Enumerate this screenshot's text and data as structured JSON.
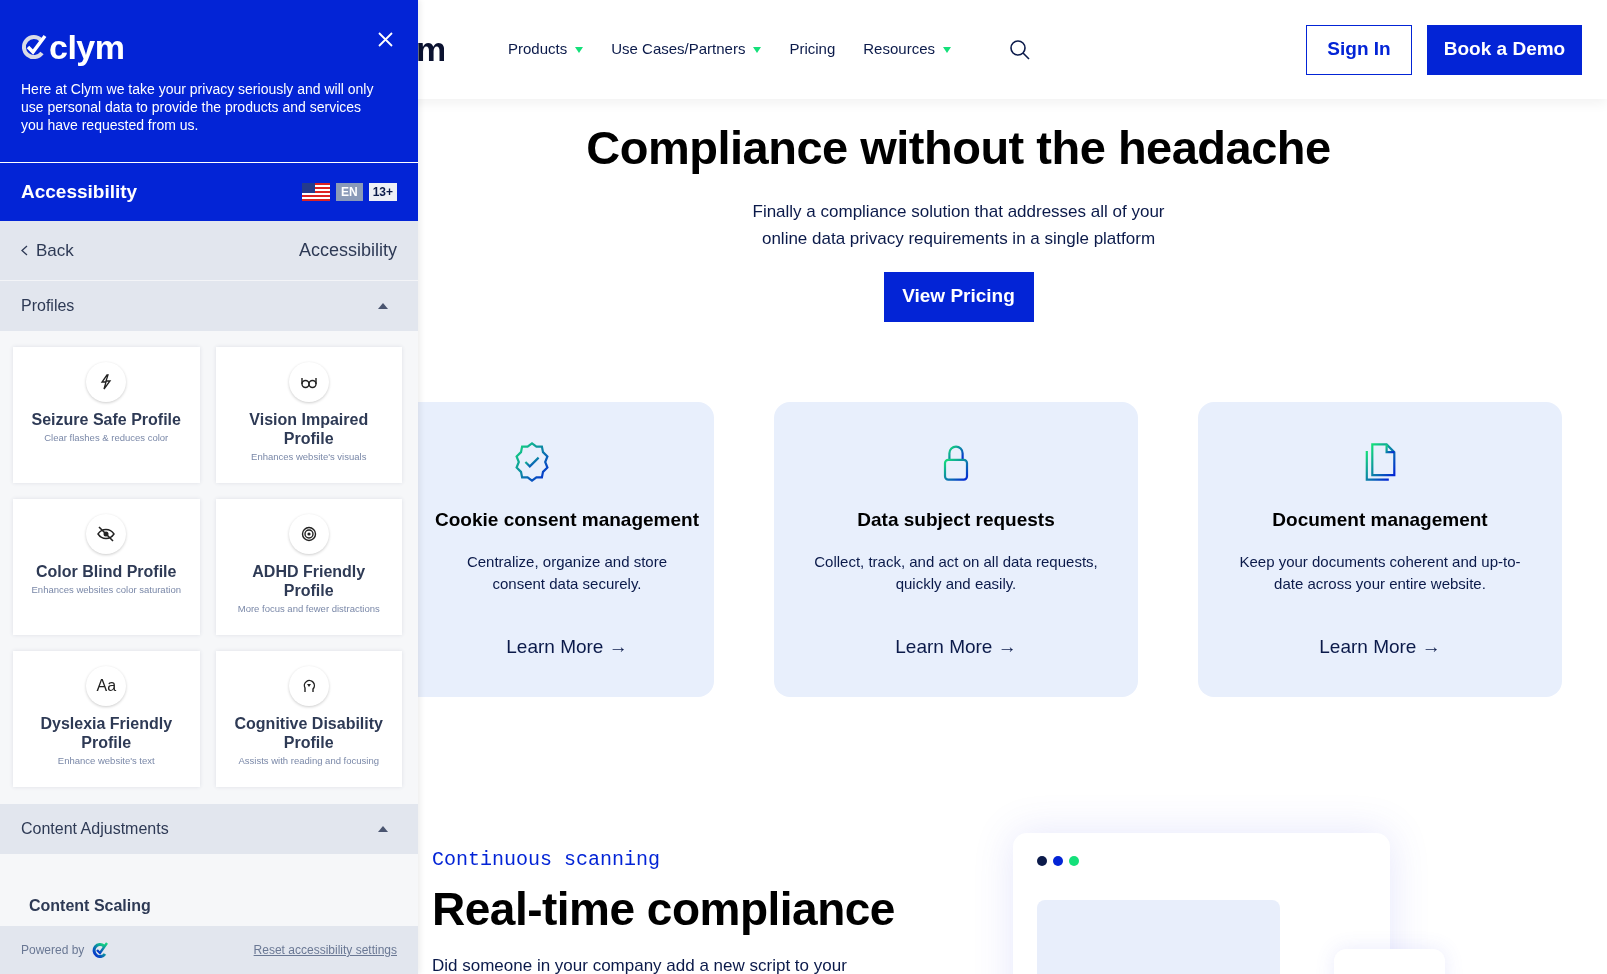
{
  "site_header": {
    "logo_visible": "m",
    "nav": [
      {
        "label": "Products",
        "dropdown": true
      },
      {
        "label": "Use Cases/Partners",
        "dropdown": true
      },
      {
        "label": "Pricing",
        "dropdown": false
      },
      {
        "label": "Resources",
        "dropdown": true
      }
    ],
    "sign_in": "Sign In",
    "book_demo": "Book a Demo"
  },
  "hero": {
    "title": "Compliance without the headache",
    "subtitle_lines": [
      "Finally a compliance solution that addresses all of your",
      "online data privacy requirements in a single platform"
    ],
    "button": "View Pricing"
  },
  "features": [
    {
      "title": "Cookie consent management",
      "description_lines": [
        "Centralize, organize and store",
        "consent data securely."
      ],
      "link": "Learn More →"
    },
    {
      "title": "Data subject requests",
      "description_lines": [
        "Collect, track, and act on all data requests,",
        "quickly and easily."
      ],
      "link": "Learn More →"
    },
    {
      "title": "Document management",
      "description_lines": [
        "Keep your documents coherent and up-to-",
        "date across your entire website."
      ],
      "link": "Learn More →"
    }
  ],
  "scanning": {
    "eyebrow": "Continuous scanning",
    "title": "Real-time compliance",
    "body": "Did someone in your company add a new script to your",
    "mockup_dots": [
      {
        "color": "#0b1a4a"
      },
      {
        "color": "#0324d6"
      },
      {
        "color": "#14e07a"
      }
    ]
  },
  "panel": {
    "logo": "clym",
    "intro": "Here at Clym we take your privacy seriously and will only use personal data to provide the products and services you have requested from us.",
    "bar_title": "Accessibility",
    "language": "EN",
    "age": "13+",
    "back": "Back",
    "page_title": "Accessibility",
    "sections": [
      {
        "title": "Profiles",
        "expanded": true
      },
      {
        "title": "Content Adjustments",
        "expanded": true
      }
    ],
    "profiles": [
      {
        "title": "Seizure Safe Profile",
        "description": "Clear flashes & reduces color"
      },
      {
        "title": "Vision Impaired Profile",
        "description": "Enhances website's visuals"
      },
      {
        "title": "Color Blind Profile",
        "description": "Enhances websites color saturation"
      },
      {
        "title": "ADHD Friendly Profile",
        "description": "More focus and fewer distractions"
      },
      {
        "title": "Dyslexia Friendly Profile",
        "description": "Enhance website's text",
        "icon_text": "Aa"
      },
      {
        "title": "Cognitive Disability Profile",
        "description": "Assists with reading and focusing"
      }
    ],
    "content_item": "Content Scaling",
    "powered_by": "Powered by",
    "reset": "Reset accessibility settings"
  }
}
